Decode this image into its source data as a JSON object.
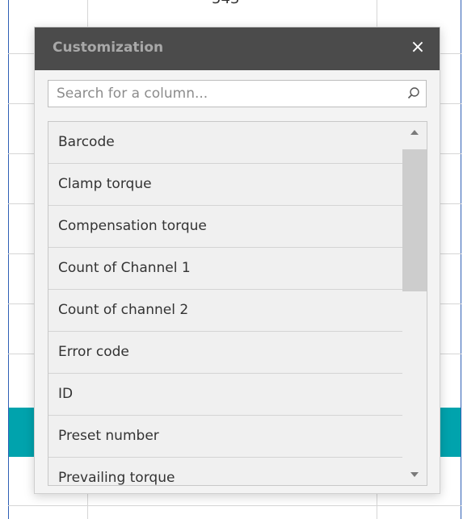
{
  "background": {
    "partial_cell_text": "543",
    "accent_color": "#00a3ad"
  },
  "panel": {
    "title": "Customization",
    "close_label": "×",
    "search": {
      "value": "",
      "placeholder": "Search for a column..."
    },
    "columns": [
      "Barcode",
      "Clamp torque",
      "Compensation torque",
      "Count of Channel 1",
      "Count of channel 2",
      "Error code",
      "ID",
      "Preset number",
      "Prevailing torque"
    ]
  }
}
